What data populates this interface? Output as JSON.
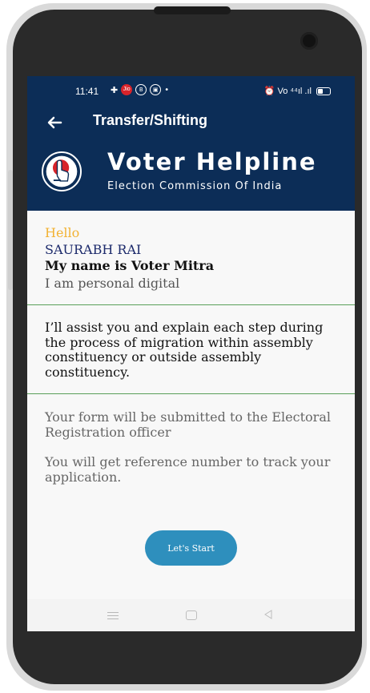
{
  "status_bar": {
    "time": "11:41",
    "left_icons": [
      "grid-icon",
      "jio-icon",
      "b-icon",
      "sim-icon",
      "dot-icon"
    ],
    "right_text": "⏰ Vo ⁴⁴ıl .ıl"
  },
  "toolbar": {
    "title": "Transfer/Shifting"
  },
  "brand": {
    "title": "Voter Helpline",
    "subtitle": "Election Commission Of India"
  },
  "intro": {
    "hello": "Hello",
    "user_name": "SAURABH RAI",
    "my_name": "My name is Voter Mitra",
    "personal": "I am personal digital"
  },
  "assist_text": "I’ll assist you and explain each step during the process of migration within assembly constituency or outside assembly constituency.",
  "form_text": "Your form will be submitted to the Electoral Registration officer",
  "reference_text": "You will get reference number to track your application.",
  "start_button_label": "Let's Start",
  "colors": {
    "header_bg": "#0c2d57",
    "hello": "#f2b233",
    "button": "#2e8fbd",
    "divider": "#5aa05a"
  }
}
